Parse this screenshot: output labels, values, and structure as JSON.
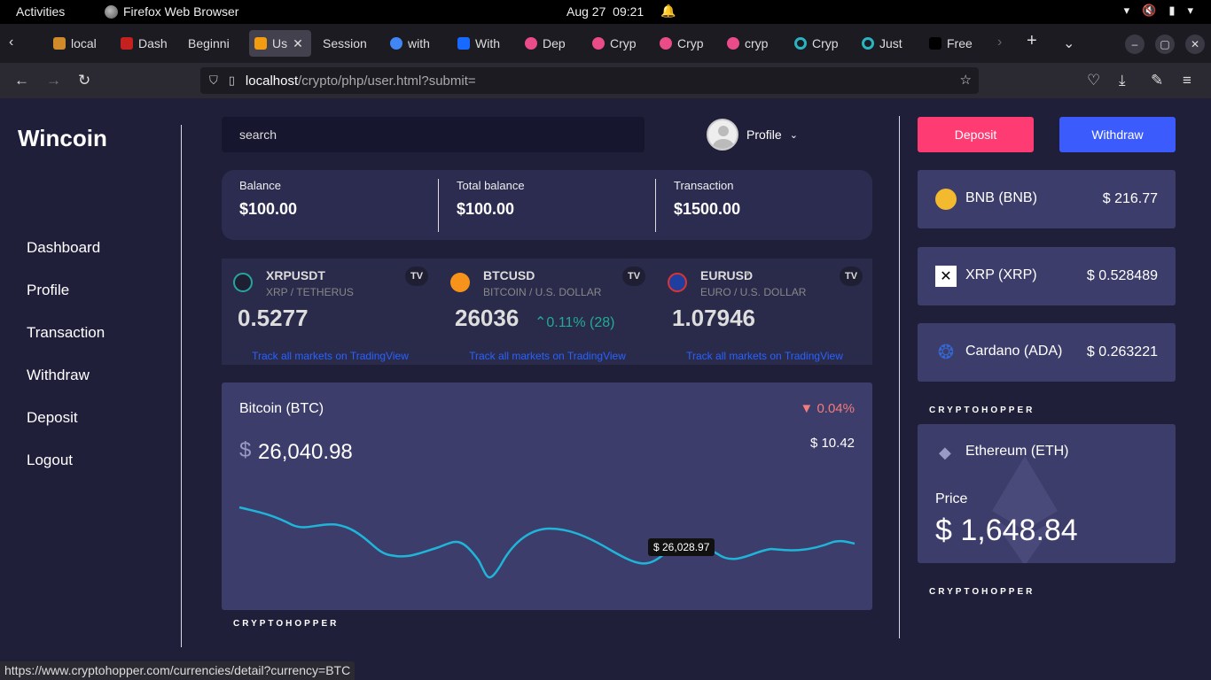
{
  "system": {
    "activities": "Activities",
    "app_name": "Firefox Web Browser",
    "date": "Aug 27",
    "time": "09:21"
  },
  "tabs": [
    {
      "label": "local",
      "color": "#d08a2c"
    },
    {
      "label": "Dash",
      "color": "#c5221f"
    },
    {
      "label": "Beginni",
      "color": ""
    },
    {
      "label": "Us",
      "color": "#f39c12"
    },
    {
      "label": "Session",
      "color": ""
    },
    {
      "label": "with",
      "color": "#4285f4"
    },
    {
      "label": "With",
      "color": "#1769ff"
    },
    {
      "label": "Dep",
      "color": "#ea4c89"
    },
    {
      "label": "Cryp",
      "color": "#ea4c89"
    },
    {
      "label": "Cryp",
      "color": "#ea4c89"
    },
    {
      "label": "cryp",
      "color": "#ea4c89"
    },
    {
      "label": "Cryp",
      "color": "#2ab4c0"
    },
    {
      "label": "Just",
      "color": "#2ab4c0"
    },
    {
      "label": "Free",
      "color": "#ffffff"
    }
  ],
  "browser": {
    "url_host": "localhost",
    "url_path": "/crypto/php/user.html?submit=",
    "status_url": "https://www.cryptohopper.com/currencies/detail?currency=BTC"
  },
  "brand": "Wincoin",
  "nav": [
    "Dashboard",
    "Profile",
    "Transaction",
    "Withdraw",
    "Deposit",
    "Logout"
  ],
  "search_placeholder": "search",
  "profile_label": "Profile",
  "balances": [
    {
      "label": "Balance",
      "value": "$100.00"
    },
    {
      "label": "Total balance",
      "value": "$100.00"
    },
    {
      "label": "Transaction",
      "value": "$1500.00"
    }
  ],
  "tickers": [
    {
      "symbol": "XRPUSDT",
      "name": "XRP / TETHERUS",
      "price": "0.5277",
      "change": "",
      "link": "Track all markets on TradingView"
    },
    {
      "symbol": "BTCUSD",
      "name": "BITCOIN / U.S. DOLLAR",
      "price": "26036",
      "change": "0.11% (28)",
      "link": "Track all markets on TradingView"
    },
    {
      "symbol": "EURUSD",
      "name": "EURO / U.S. DOLLAR",
      "price": "1.07946",
      "change": "",
      "link": "Track all markets on TradingView"
    }
  ],
  "btc": {
    "name": "Bitcoin (BTC)",
    "change": "0.04%",
    "currency": "$",
    "price": "26,040.98",
    "delta": "$ 10.42",
    "tooltip": "$ 26,028.97"
  },
  "actions": {
    "deposit": "Deposit",
    "withdraw": "Withdraw",
    "deposit_color": "#ff3b74",
    "withdraw_color": "#3b5bfd"
  },
  "coins": [
    {
      "name": "BNB (BNB)",
      "price": "$ 216.77"
    },
    {
      "name": "XRP (XRP)",
      "price": "$ 0.528489"
    },
    {
      "name": "Cardano (ADA)",
      "price": "$ 0.263221"
    }
  ],
  "eth": {
    "name": "Ethereum (ETH)",
    "price_label": "Price",
    "price": "$ 1,648.84"
  },
  "cryptohopper": "CRYPTOHOPPER"
}
